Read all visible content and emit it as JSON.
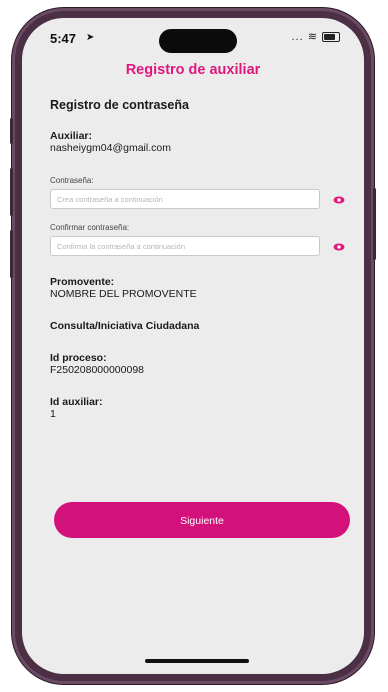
{
  "status_bar": {
    "time": "5:47",
    "indicators": "... ≋"
  },
  "header": {
    "title": "Registro de auxiliar"
  },
  "form": {
    "section_title": "Registro de contraseña",
    "auxiliar_label": "Auxiliar:",
    "auxiliar_value": "nasheiygm04@gmail.com",
    "password_label": "Contraseña:",
    "password_placeholder": "Crea contraseña a continuación",
    "confirm_label": "Confirmar contraseña:",
    "confirm_placeholder": "Confirma la contraseña a continuación",
    "promovente_label": "Promovente:",
    "promovente_value": "NOMBRE DEL PROMOVENTE",
    "tramite": "Consulta/Iniciativa Ciudadana",
    "proceso_label": "Id proceso:",
    "proceso_value": "F250208000000098",
    "auxiliar_id_label": "Id auxiliar:",
    "auxiliar_id_value": "1"
  },
  "actions": {
    "next_label": "Siguiente"
  },
  "colors": {
    "accent": "#d4107a",
    "title": "#e0177f",
    "frame": "#4a2f45",
    "background": "#ececec"
  }
}
